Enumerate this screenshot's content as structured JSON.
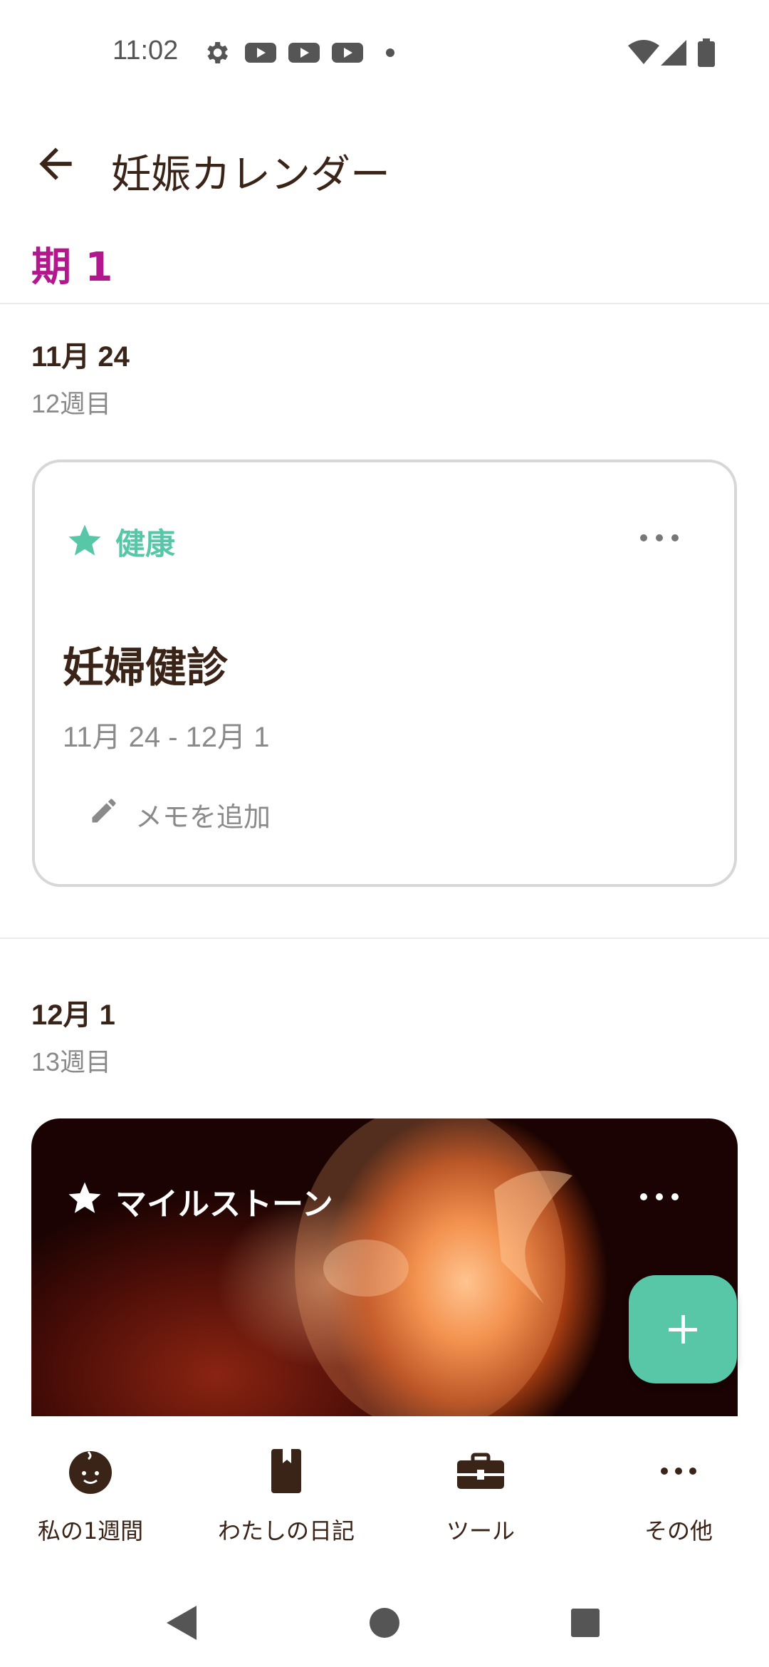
{
  "status_bar": {
    "time": "11:02",
    "icons": [
      "gear-icon",
      "youtube-icon",
      "youtube-icon",
      "youtube-icon",
      "dot-icon",
      "wifi-icon",
      "signal-icon",
      "battery-icon"
    ]
  },
  "app_bar": {
    "title": "妊娠カレンダー",
    "back_icon": "arrow-left-icon"
  },
  "period": {
    "title": "期 1"
  },
  "entries": [
    {
      "date": "11月 24",
      "week": "12週目",
      "card": {
        "category": "健康",
        "category_icon": "star-icon",
        "category_color": "#57c7a8",
        "title": "妊婦健診",
        "range": "11月 24 - 12月 1",
        "add_memo": "メモを追加"
      }
    },
    {
      "date": "12月 1",
      "week": "13週目",
      "card": {
        "category": "マイルストーン",
        "category_icon": "star-icon"
      }
    }
  ],
  "fab": {
    "icon": "plus-icon",
    "color": "#57c7a8"
  },
  "bottom_nav": [
    {
      "label": "私の1週間",
      "icon": "baby-face-icon"
    },
    {
      "label": "わたしの日記",
      "icon": "diary-book-icon"
    },
    {
      "label": "ツール",
      "icon": "toolbox-icon"
    },
    {
      "label": "その他",
      "icon": "more-horizontal-icon"
    }
  ],
  "colors": {
    "accent_magenta": "#b3178e",
    "accent_green": "#57c7a8",
    "text_dark": "#3a2418",
    "text_gray": "#8a8a8a"
  }
}
